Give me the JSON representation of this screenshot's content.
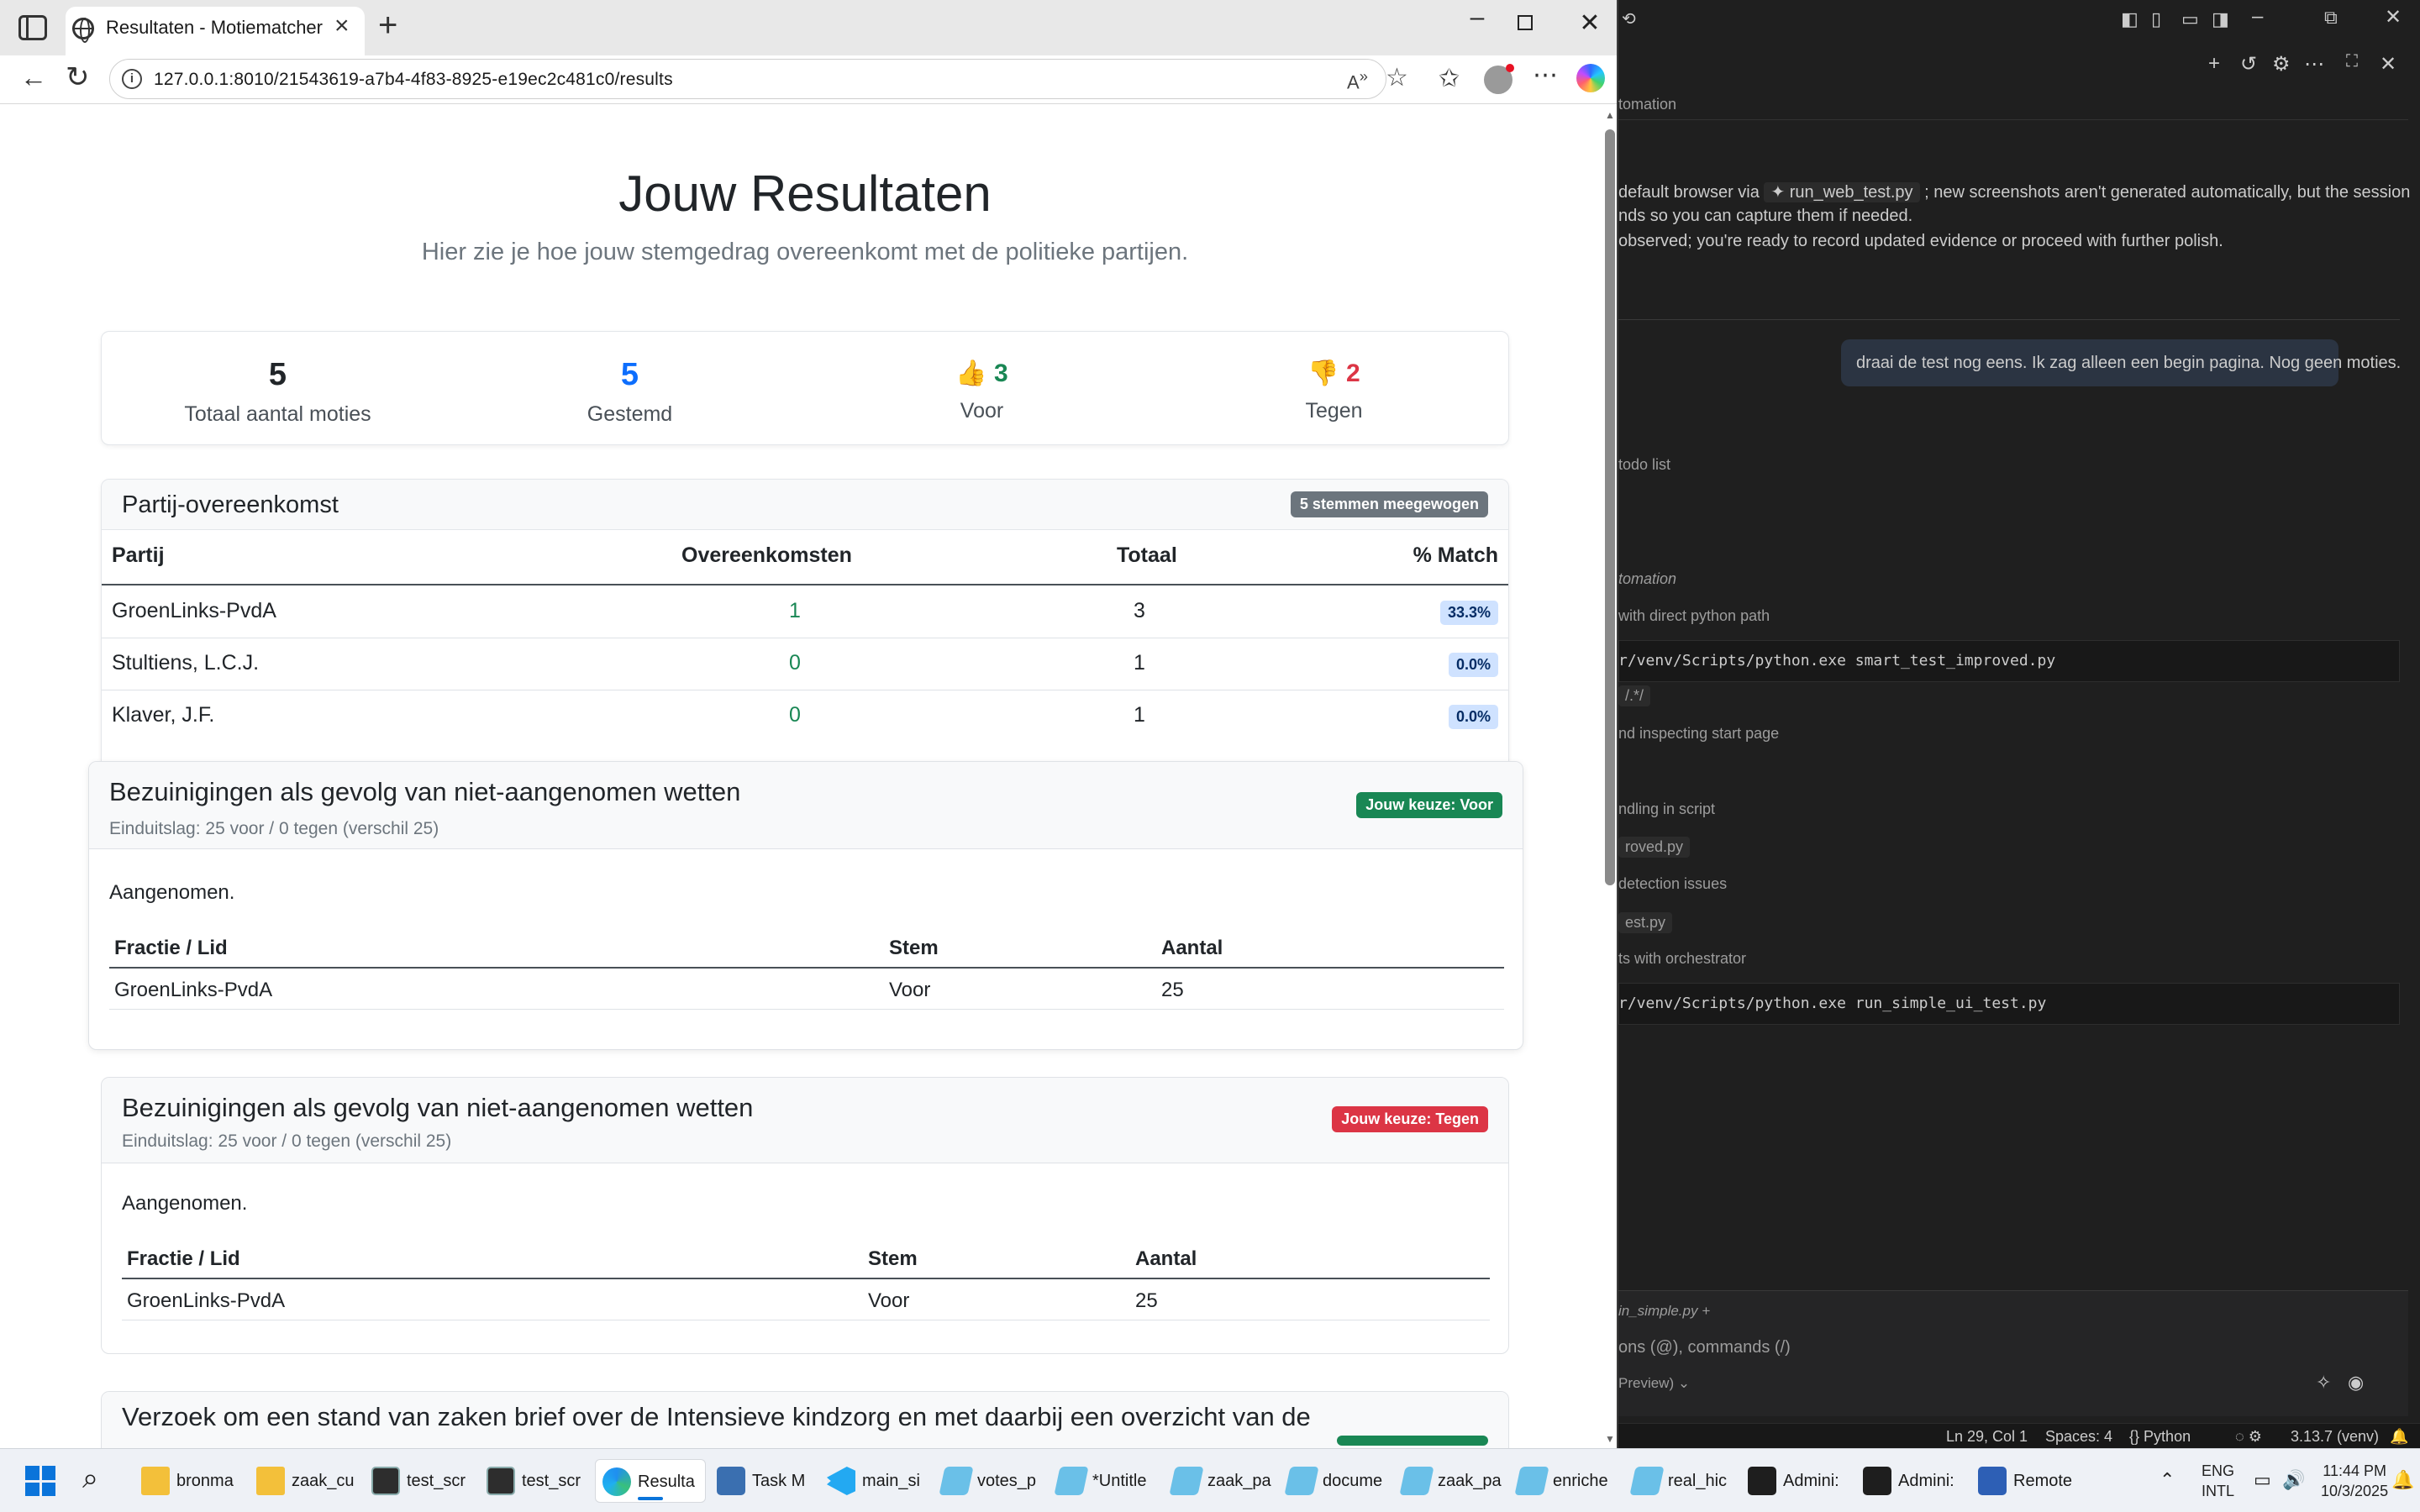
{
  "browser": {
    "tab_title": "Resultaten - Motiematcher",
    "url": "127.0.0.1:8010/21543619-a7b4-4f83-8925-e19ec2c481c0/results"
  },
  "page": {
    "title": "Jouw Resultaten",
    "subtitle": "Hier zie je hoe jouw stemgedrag overeenkomt met de politieke partijen."
  },
  "stats": {
    "total_value": "5",
    "total_label": "Totaal aantal moties",
    "voted_value": "5",
    "voted_label": "Gestemd",
    "for_value": "3",
    "for_label": "Voor",
    "against_value": "2",
    "against_label": "Tegen",
    "voted_color": "#0d6efd"
  },
  "party_card": {
    "title": "Partij-overeenkomst",
    "badge": "5 stemmen meegewogen",
    "columns": [
      "Partij",
      "Overeenkomsten",
      "Totaal",
      "% Match"
    ],
    "rows": [
      {
        "party": "GroenLinks-PvdA",
        "matches": "1",
        "total": "3",
        "pct": "33.3%"
      },
      {
        "party": "Stultiens, L.C.J.",
        "matches": "0",
        "total": "1",
        "pct": "0.0%"
      },
      {
        "party": "Klaver, J.F.",
        "matches": "0",
        "total": "1",
        "pct": "0.0%"
      }
    ]
  },
  "motions": [
    {
      "title": "Bezuinigingen als gevolg van niet-aangenomen wetten",
      "meta": "Einduitslag: 25 voor / 0 tegen (verschil 25)",
      "choice": "Jouw keuze: Voor",
      "status": "Aangenomen.",
      "columns": [
        "Fractie / Lid",
        "Stem",
        "Aantal"
      ],
      "row": {
        "fractie": "GroenLinks-PvdA",
        "stem": "Voor",
        "aantal": "25"
      }
    },
    {
      "title": "Bezuinigingen als gevolg van niet-aangenomen wetten",
      "meta": "Einduitslag: 25 voor / 0 tegen (verschil 25)",
      "choice": "Jouw keuze: Tegen",
      "status": "Aangenomen.",
      "columns": [
        "Fractie / Lid",
        "Stem",
        "Aantal"
      ],
      "row": {
        "fractie": "GroenLinks-PvdA",
        "stem": "Voor",
        "aantal": "25"
      }
    },
    {
      "title": "Verzoek om een stand van zaken brief over de Intensieve kindzorg en met daarbij een overzicht van de"
    }
  ],
  "panel": {
    "header_label": "tomation",
    "msg1_a": "default browser via",
    "msg1_chip": "run_web_test.py",
    "msg1_b": "; new screenshots aren't generated automatically, but the session",
    "msg1_line2": "nds so you can capture them if needed.",
    "msg1_line3": "observed; you're ready to record updated evidence or proceed with further polish.",
    "user_msg": "draai de test nog eens. Ik zag alleen een begin pagina. Nog geen moties.",
    "todo": "todo list",
    "automation": "tomation",
    "step1": "with direct python path",
    "code1": "r/venv/Scripts/python.exe smart_test_improved.py",
    "chip1": "/.*/",
    "step2": "nd inspecting start page",
    "step3": "ndling in script",
    "chip2": "roved.py",
    "step4": "detection issues",
    "chip3": "est.py",
    "step5": "ts with orchestrator",
    "code2": "r/venv/Scripts/python.exe run_simple_ui_test.py",
    "input_file": "in_simple.py",
    "input_placeholder": "ons (@), commands (/)",
    "mode": "Preview)",
    "status_ln": "Ln 29, Col 1",
    "status_spaces": "Spaces: 4",
    "status_lang": "Python",
    "status_ver": "3.13.7 (venv)"
  },
  "taskbar": {
    "items": [
      "bronma",
      "zaak_cu",
      "test_scr",
      "test_scr",
      "Resulta",
      "Task M",
      "main_si",
      "votes_p",
      "*Untitle",
      "zaak_pa",
      "docume",
      "zaak_pa",
      "enriche",
      "real_hic",
      "Admini:",
      "Admini:",
      "Remote"
    ],
    "lang_top": "ENG",
    "lang_bottom": "INTL",
    "time": "11:44 PM",
    "date": "10/3/2025"
  }
}
